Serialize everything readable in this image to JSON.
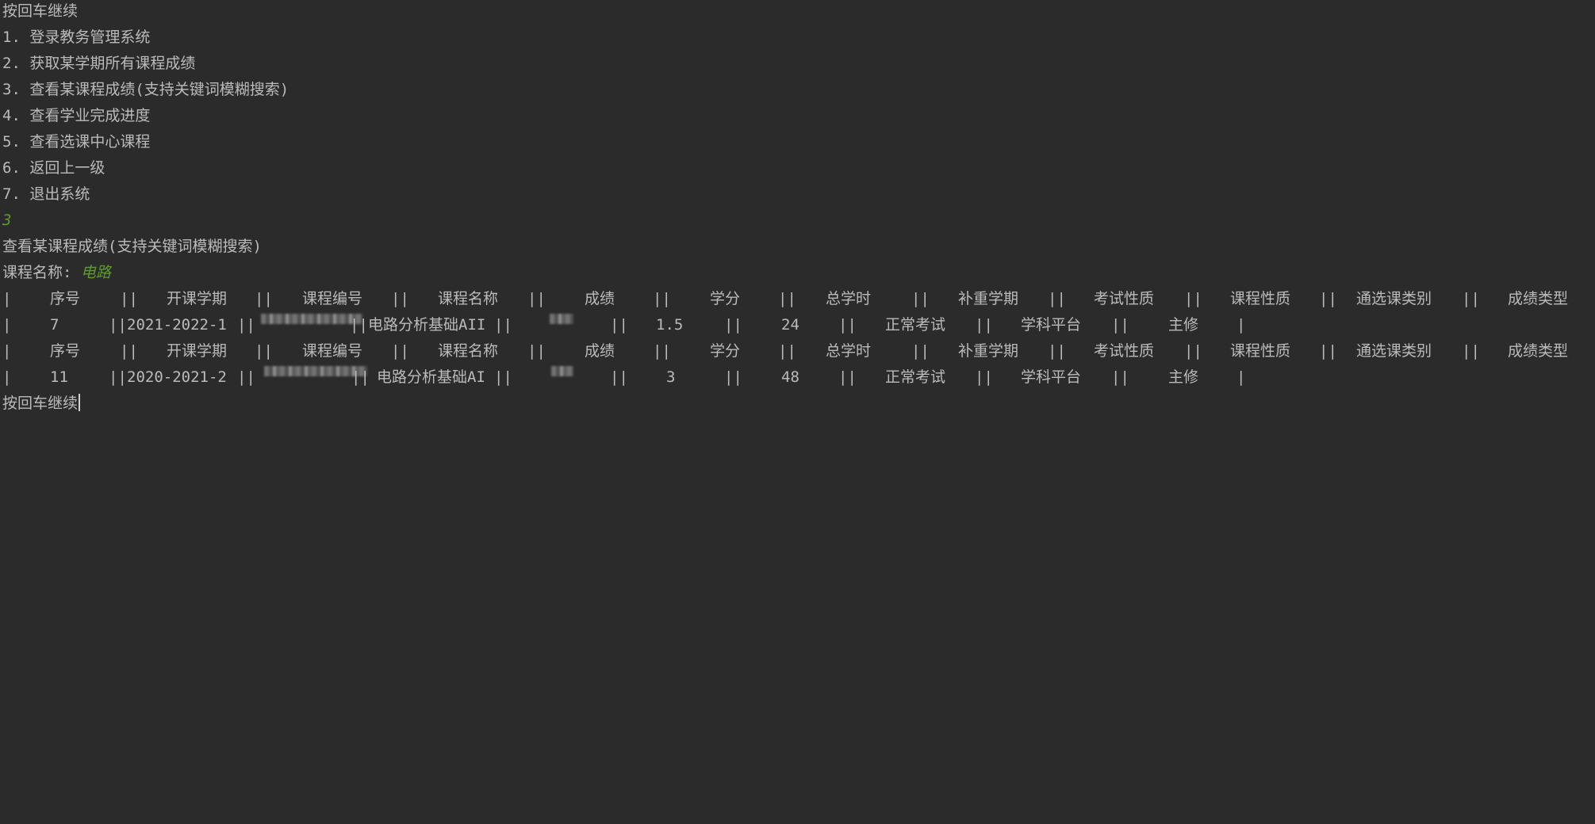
{
  "lines": {
    "prompt_top": "按回车继续",
    "menu": [
      "1. 登录教务管理系统",
      "2. 获取某学期所有课程成绩",
      "3. 查看某课程成绩(支持关键词模糊搜索)",
      "4. 查看学业完成进度",
      "5. 查看选课中心课程",
      "6. 返回上一级",
      "7. 退出系统"
    ],
    "user_choice": "3",
    "section_title": "查看某课程成绩(支持关键词模糊搜索)",
    "course_name_label": "课程名称: ",
    "course_name_input": "电路",
    "prompt_bottom": "按回车继续"
  },
  "table": {
    "headers": [
      "序号",
      "开课学期",
      "课程编号",
      "课程名称",
      "成绩",
      "学分",
      "总学时",
      "补重学期",
      "考试性质",
      "课程性质",
      "通选课类别",
      "成绩类型"
    ],
    "rows": [
      {
        "index": "7",
        "term": "2021-2022-1",
        "course_name": "电路分析基础AII",
        "credit": "1.5",
        "hours": "24",
        "exam_type": "正常考试",
        "course_type": "学科平台",
        "category": "主修"
      },
      {
        "index": "11",
        "term": "2020-2021-2",
        "course_name": "电路分析基础AI",
        "credit": "3",
        "hours": "48",
        "exam_type": "正常考试",
        "course_type": "学科平台",
        "category": "主修"
      }
    ]
  },
  "colors": {
    "background": "#2b2b2b",
    "text": "#bbbbbb",
    "input": "#5f9a2c"
  }
}
